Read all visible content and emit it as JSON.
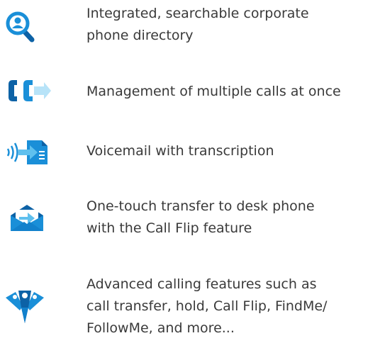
{
  "features": [
    {
      "icon": "search-person-icon",
      "text": "Integrated, searchable corporate\nphone directory"
    },
    {
      "icon": "multiple-calls-icon",
      "text": "Management of multiple calls at once"
    },
    {
      "icon": "voicemail-transcription-icon",
      "text": "Voicemail with transcription"
    },
    {
      "icon": "call-flip-envelope-icon",
      "text": "One-touch transfer to desk phone\nwith the Call Flip feature"
    },
    {
      "icon": "advanced-calling-icon",
      "text": "Advanced calling features such as\ncall transfer, hold, Call Flip, FindMe/\nFollowMe, and more..."
    }
  ],
  "colors": {
    "primary": "#1a8fd8",
    "dark": "#0d62a6",
    "light": "#5fc0ee",
    "text": "#3a3a3a"
  }
}
